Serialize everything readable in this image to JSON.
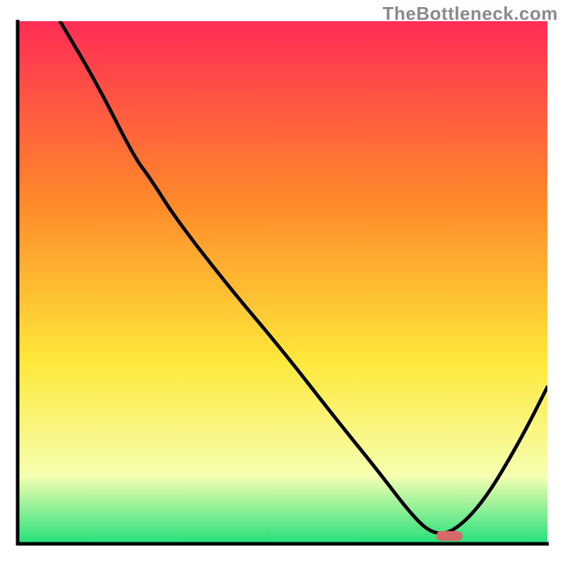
{
  "watermark": "TheBottleneck.com",
  "colors": {
    "gradient_top": "#ff2d55",
    "gradient_mid1": "#ff8a2a",
    "gradient_mid2": "#ffe83a",
    "gradient_mid3": "#f6ffb0",
    "gradient_bottom": "#22e07a",
    "curve": "#000000",
    "marker": "#d46a6a",
    "axis": "#000000"
  },
  "chart_data": {
    "type": "line",
    "title": "",
    "xlabel": "",
    "ylabel": "",
    "xlim": [
      0,
      100
    ],
    "ylim": [
      0,
      100
    ],
    "grid": false,
    "legend": false,
    "note": "x/y are normalized 0–100 because the chart has no tick labels; values read off pixel positions.",
    "series": [
      {
        "name": "curve",
        "x": [
          8,
          15,
          22,
          25,
          30,
          40,
          50,
          60,
          68,
          74,
          78,
          82,
          88,
          95,
          100
        ],
        "y": [
          100,
          88,
          74,
          70,
          62,
          49,
          37,
          24,
          14,
          6,
          2,
          2,
          8,
          20,
          30
        ]
      }
    ],
    "marker": {
      "type": "capsule",
      "x_range": [
        79,
        84
      ],
      "y": 1.5
    },
    "gradient_stops": [
      {
        "offset": 0.0,
        "color": "#ff2d55"
      },
      {
        "offset": 0.35,
        "color": "#ff8a2a"
      },
      {
        "offset": 0.65,
        "color": "#ffe83a"
      },
      {
        "offset": 0.87,
        "color": "#f6ffb0"
      },
      {
        "offset": 1.0,
        "color": "#22e07a"
      }
    ]
  }
}
